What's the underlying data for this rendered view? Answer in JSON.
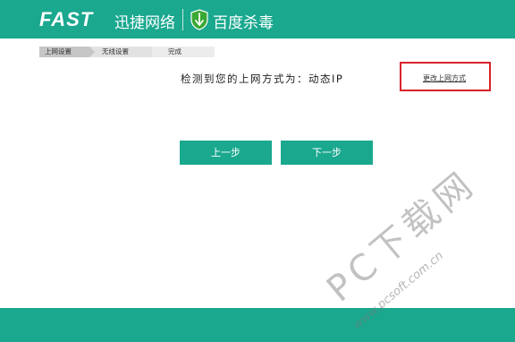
{
  "header": {
    "brand": "FAST",
    "brand_cn": "迅捷网络",
    "partner": "百度杀毒"
  },
  "steps": [
    {
      "label": "上网设置",
      "active": true
    },
    {
      "label": "无线设置",
      "active": false
    },
    {
      "label": "完成",
      "active": false
    }
  ],
  "main": {
    "detect_text": "检测到您的上网方式为：动态IP",
    "change_link": "更改上网方式"
  },
  "buttons": {
    "prev": "上一步",
    "next": "下一步"
  },
  "watermark": {
    "main": "PC下载网",
    "url": "www.pcsoft.com.cn"
  },
  "colors": {
    "brand_teal": "#1aa88f",
    "highlight_red": "#d9232a",
    "shield_green": "#3aa832"
  }
}
